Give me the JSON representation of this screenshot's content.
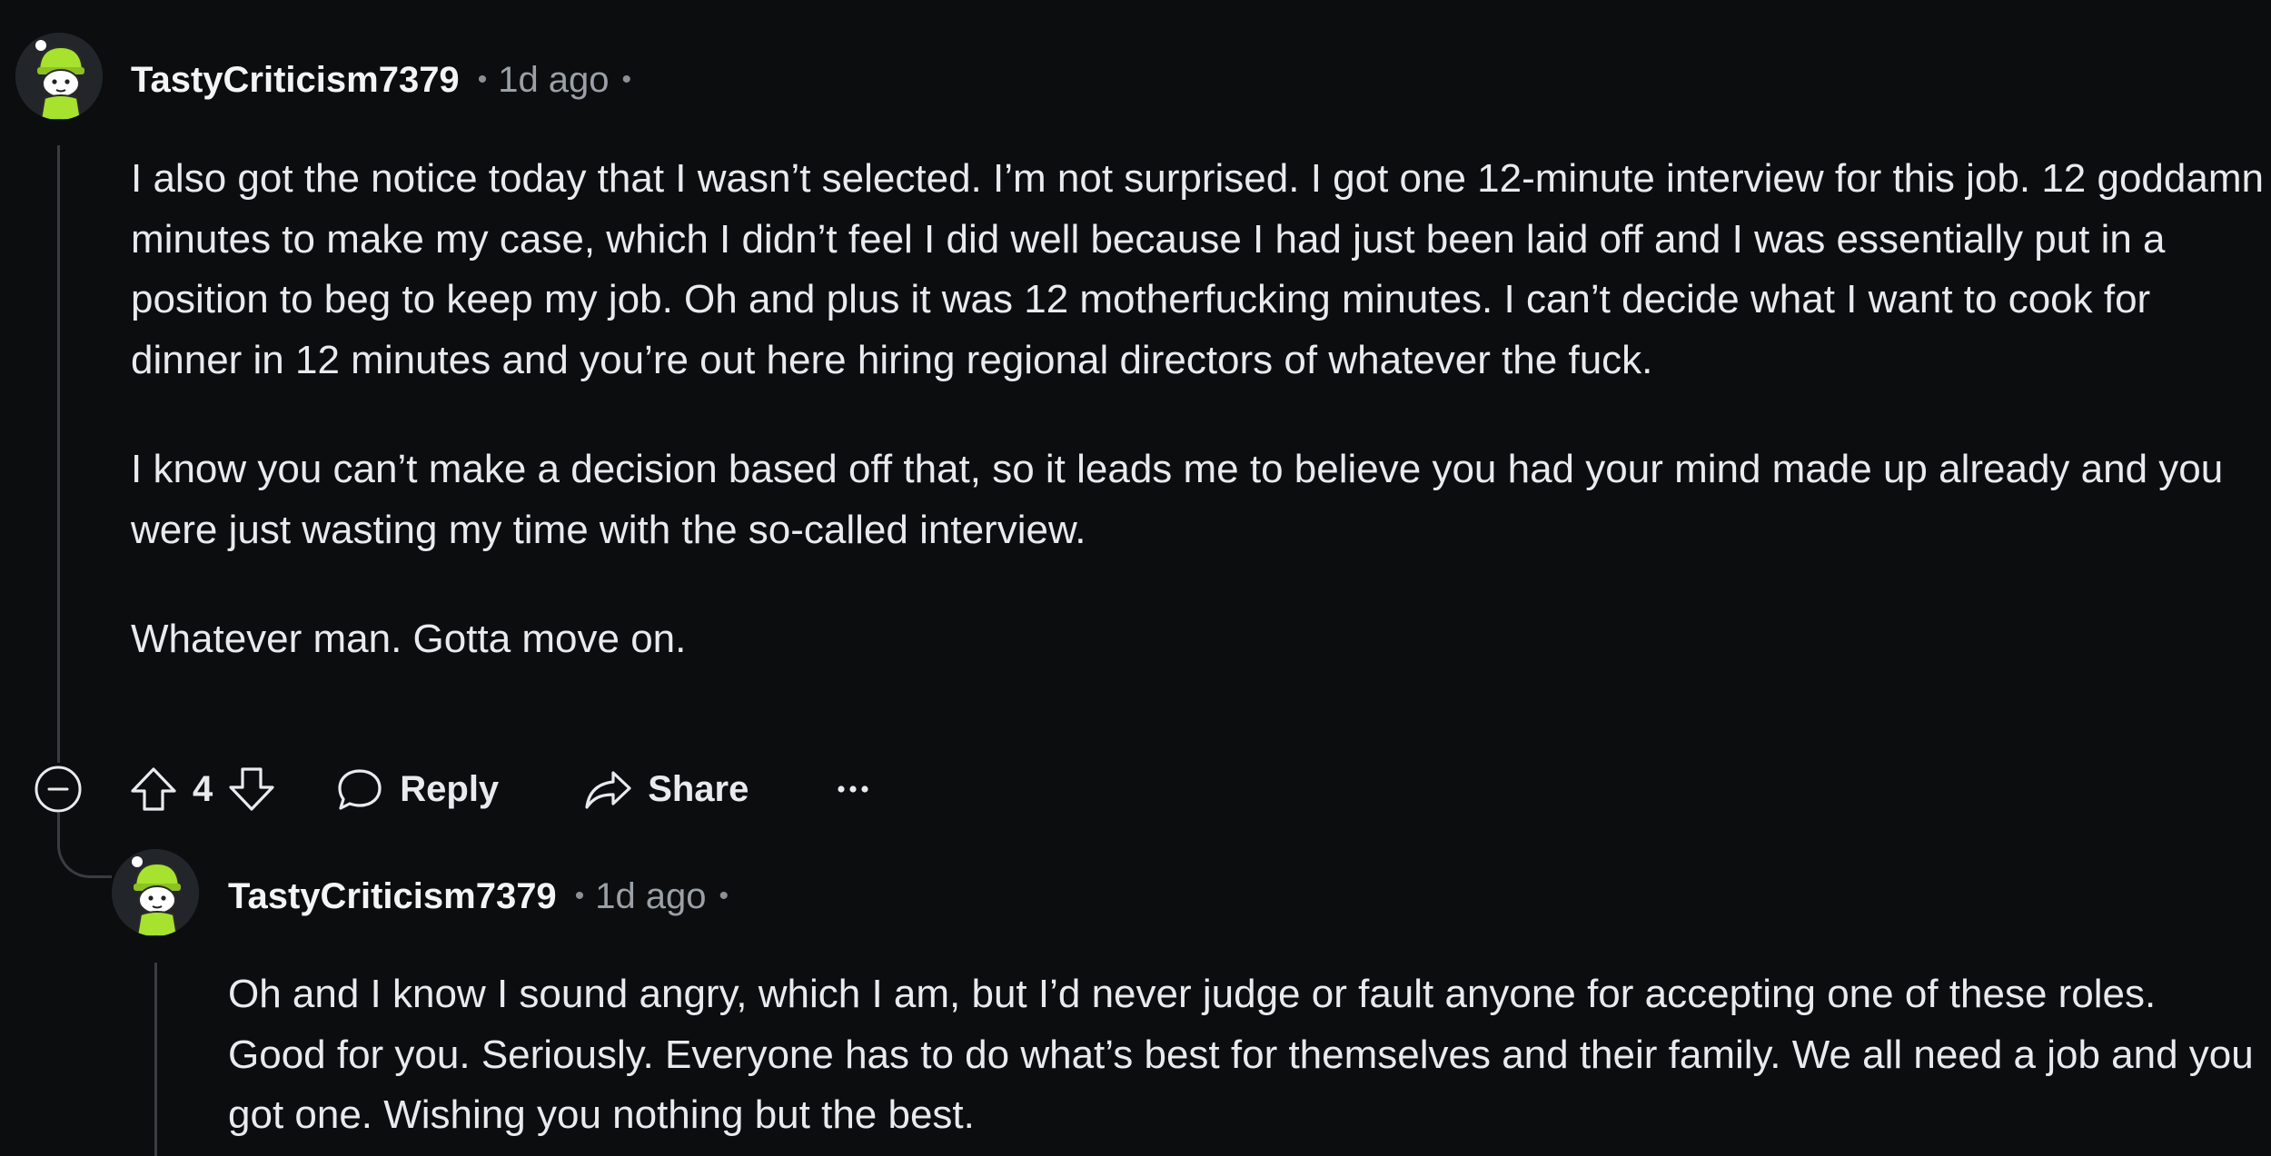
{
  "comment": {
    "username": "TastyCriticism7379",
    "separator": "•",
    "time": "1d ago",
    "paragraphs": [
      "I also got the notice today that I wasn’t selected. I’m not surprised. I got one 12-minute interview for this job. 12 goddamn minutes to make my case, which I didn’t feel I did well because I had just been laid off and I was essentially put in a position to beg to keep my job. Oh and plus it was 12 motherfucking minutes. I can’t decide what I want to cook for dinner in 12 minutes and you’re out here hiring regional directors of whatever the fuck.",
      "I know you can’t make a decision based off that, so it leads me to believe you had your mind made up already and you were just wasting my time with the so-called interview.",
      "Whatever man. Gotta move on."
    ],
    "actions": {
      "vote_count": "4",
      "reply_label": "Reply",
      "share_label": "Share",
      "more_label": "···"
    }
  },
  "reply": {
    "username": "TastyCriticism7379",
    "separator": "•",
    "time": "1d ago",
    "paragraphs": [
      "Oh and I know I sound angry, which I am, but I’d never judge or fault anyone for accepting one of these roles. Good for you. Seriously. Everyone has to do what’s best for themselves and their family. We all need a job and you got one. Wishing you nothing but the best."
    ]
  },
  "colors": {
    "background": "#0b0d0f",
    "text": "#e8ebed",
    "meta": "#9aa0a6",
    "thread_line": "#3a3d40",
    "avatar_green": "#a6e22e"
  }
}
